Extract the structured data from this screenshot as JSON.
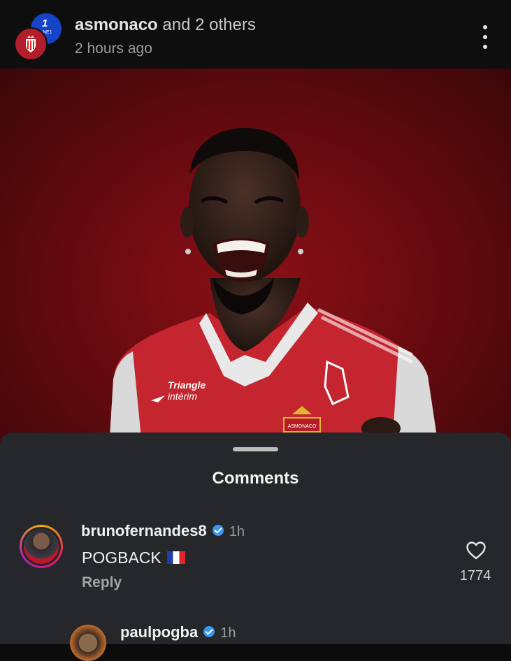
{
  "header": {
    "owner": "asmonaco",
    "collaborators": "and 2 others",
    "time": "2 hours ago",
    "avatar_back_text": "1",
    "avatar_back_sub": "NE1"
  },
  "media": {
    "sponsor_line1": "Triangle",
    "sponsor_line2": "intérim",
    "badge_text": "ASMONACO"
  },
  "comments_sheet": {
    "title": "Comments",
    "comments": [
      {
        "username": "brunofernandes8",
        "time": "1h",
        "text": "POGBACK",
        "reply_label": "Reply",
        "likes": "1774",
        "verified": true
      },
      {
        "username": "paulpogba",
        "time": "1h",
        "verified": true
      }
    ]
  },
  "colors": {
    "background": "#0c0c0c",
    "sheet": "#25272b",
    "verified": "#3897f0",
    "media_red": "#8a1016"
  },
  "icons": [
    "more-vertical-icon",
    "heart-icon",
    "verified-icon",
    "france-flag-icon"
  ]
}
